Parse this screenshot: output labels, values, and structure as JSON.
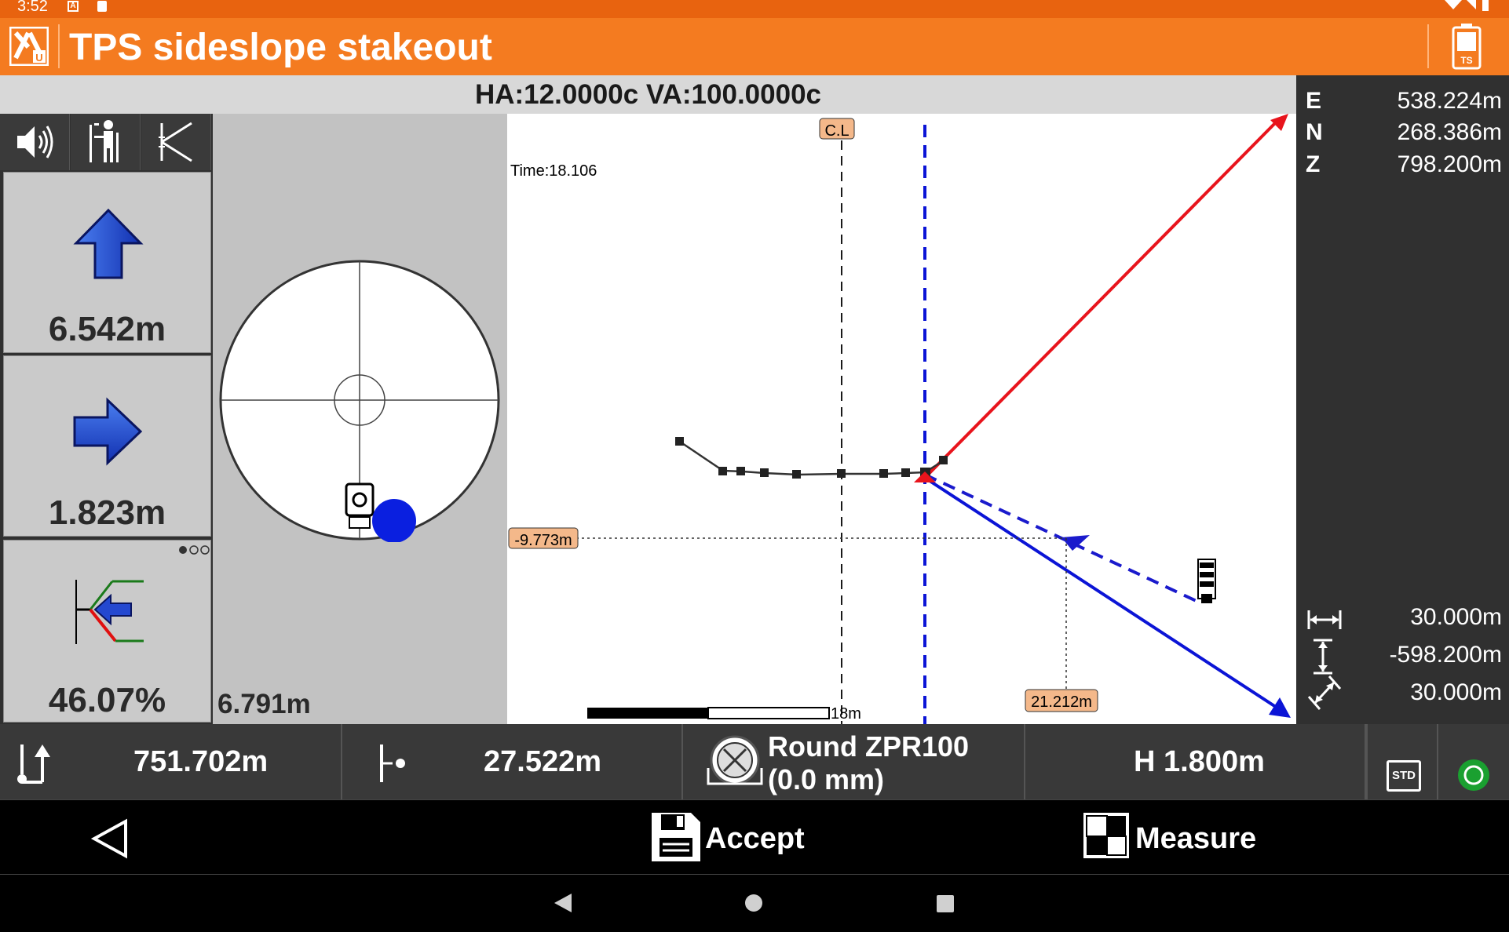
{
  "status_bar": {
    "time": "3:52"
  },
  "app": {
    "title": "TPS sideslope stakeout",
    "battery_label": "TS"
  },
  "angles": {
    "text": "HA:12.0000c  VA:100.0000c"
  },
  "left_panel": {
    "tools": [
      "speaker-icon",
      "surveyor-icon",
      "slope-icon"
    ],
    "forward": {
      "value": "6.542m",
      "direction": "up"
    },
    "side": {
      "value": "1.823m",
      "direction": "right"
    },
    "slope": {
      "value": "46.07%",
      "direction": "left"
    }
  },
  "bubble": {
    "value": "6.791m"
  },
  "plot": {
    "time_label": "Time:18.106",
    "centerline_label": "C.L",
    "offset_label": "-9.773m",
    "distance_label": "21.212m",
    "scale_label": "18m",
    "colors": {
      "red_line": "#e8141c",
      "blue_line": "#0b14d6",
      "blue_dash": "#1a1acc"
    }
  },
  "coords": [
    {
      "key": "E",
      "value": "538.224m"
    },
    {
      "key": "N",
      "value": "268.386m"
    },
    {
      "key": "Z",
      "value": "798.200m"
    }
  ],
  "dims": [
    {
      "icon": "horizontal-width-icon",
      "value": "30.000m"
    },
    {
      "icon": "vertical-height-icon",
      "value": "-598.200m"
    },
    {
      "icon": "slope-length-icon",
      "value": "30.000m"
    }
  ],
  "info_bar": {
    "height": "751.702m",
    "offset": "27.522m",
    "prism_line1": "Round ZPR100",
    "prism_line2": "(0.0 mm)",
    "instrument_height": "H 1.800m",
    "std_label": "STD"
  },
  "actions": {
    "accept": "Accept",
    "measure": "Measure"
  }
}
